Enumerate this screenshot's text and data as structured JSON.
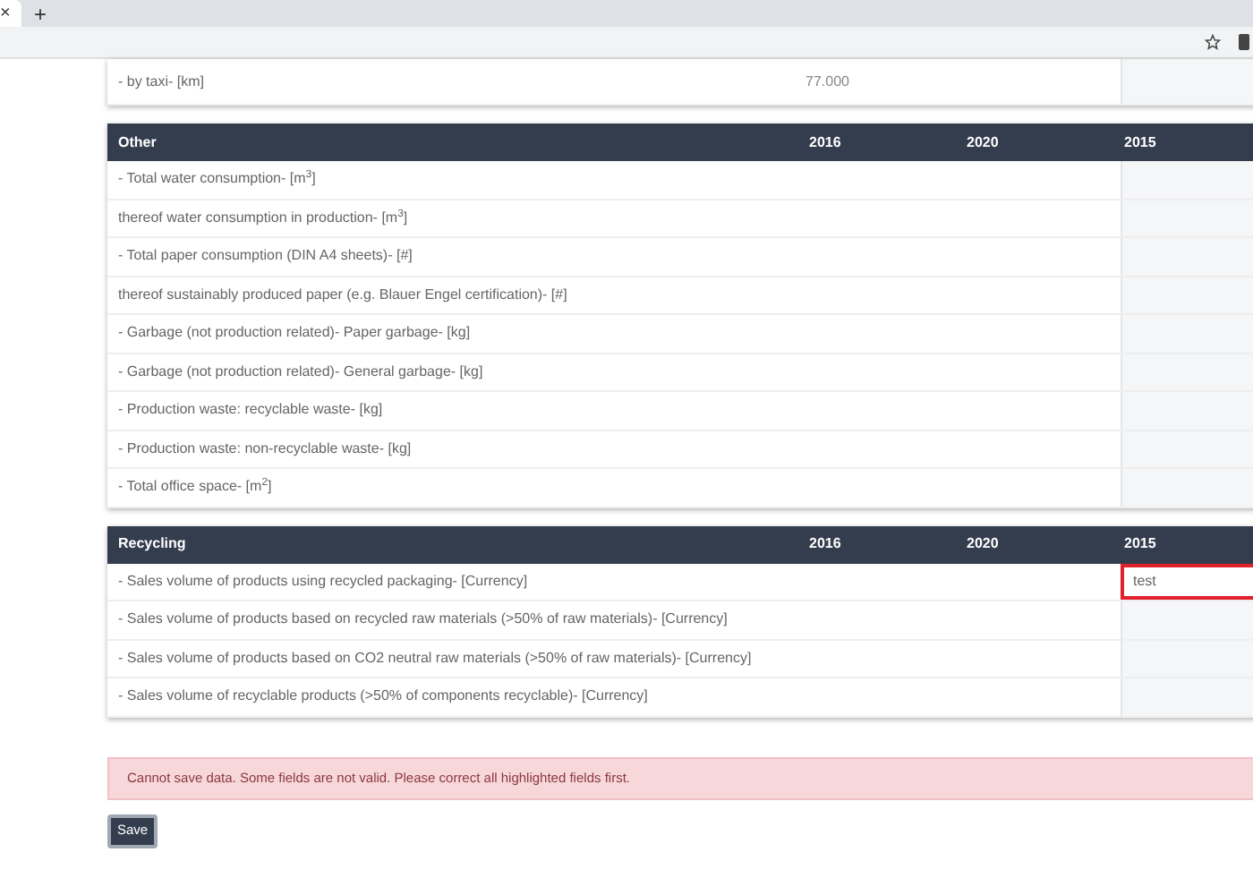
{
  "browser": {
    "tab_close": "×",
    "new_tab": "+"
  },
  "top_table": {
    "rows": [
      {
        "label": "- by taxi- [km]",
        "value_2016": "77.000",
        "invalid": false
      }
    ]
  },
  "tables": [
    {
      "title": "Other",
      "columns": [
        "2016",
        "2020",
        "2015"
      ],
      "rows": [
        {
          "label": "- Total water consumption- [m$^{3}$]",
          "invalid": false
        },
        {
          "label": "thereof water consumption in production- [m$^{3}$]",
          "invalid": false
        },
        {
          "label": "- Total paper consumption (DIN A4 sheets)- [#]",
          "invalid": false
        },
        {
          "label": "thereof sustainably produced paper (e.g. Blauer Engel certification)- [#]",
          "invalid": false
        },
        {
          "label": "- Garbage (not production related)- Paper garbage- [kg]",
          "invalid": false
        },
        {
          "label": "- Garbage (not production related)- General garbage- [kg]",
          "invalid": false
        },
        {
          "label": "- Production waste: recyclable waste- [kg]",
          "invalid": false
        },
        {
          "label": "- Production waste: non-recyclable waste- [kg]",
          "invalid": false
        },
        {
          "label": "- Total office space- [m$^{2}$]",
          "invalid": false
        }
      ]
    },
    {
      "title": "Recycling",
      "columns": [
        "2016",
        "2020",
        "2015"
      ],
      "rows": [
        {
          "label": "- Sales volume of products using recycled packaging- [Currency]",
          "input_value": "test",
          "invalid": true
        },
        {
          "label": "- Sales volume of products based on recycled raw materials (>50% of raw materials)- [Currency]",
          "invalid": false
        },
        {
          "label": "- Sales volume of products based on CO2 neutral raw materials (>50% of raw materials)- [Currency]",
          "invalid": false
        },
        {
          "label": "- Sales volume of recyclable products (>50% of components recyclable)- [Currency]",
          "invalid": false
        }
      ]
    }
  ],
  "alert": {
    "message": "Cannot save data. Some fields are not valid. Please correct all highlighted fields first."
  },
  "save_button": "Save"
}
